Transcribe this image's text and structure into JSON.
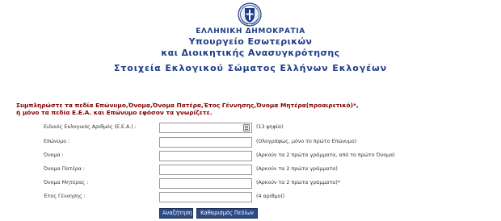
{
  "header": {
    "republic": "ΕΛΛΗΝΙΚΗ ΔΗΜΟΚΡΑΤΙΑ",
    "ministry_line1": "Υπουργείο Εσωτερικών",
    "ministry_line2": "και Διοικητικής Ανασυγκρότησης",
    "subtitle": "Στοιχεία Εκλογικού Σώματος Ελλήνων Εκλογέων"
  },
  "instructions": {
    "line1": "Συμπληρώστε τα πεδία Επώνυμο,Όνομα,Όνομα Πατέρα,Έτος Γέννησης,Όνομα Μητέρα(προαιρετικό)*,",
    "line2": "ή μόνο τα πεδία Ε.Ε.Α. και Επώνυμο εφόσον τα γνωρίζετε."
  },
  "form": {
    "fields": [
      {
        "label": "Ειδικός Εκλογικός Αριθμός (Ε.Ε.Α.) :",
        "value": "",
        "hint": "(13 ψηφία)"
      },
      {
        "label": "Επώνυμο :",
        "value": "",
        "hint": "(Ολογράφως, μόνο το πρώτο Επώνυμο)"
      },
      {
        "label": "Όνομα :",
        "value": "",
        "hint": "(Αρκούν τα 2 πρώτα γράμματα, από το πρώτο Όνομα)"
      },
      {
        "label": "Όνομα Πατέρα :",
        "value": "",
        "hint": "(Αρκούν τα 2 πρώτα γράμματα)"
      },
      {
        "label": "Όνομα Μητέρας :",
        "value": "",
        "hint": "(Αρκούν τα 2 πρώτα γράμματα)*"
      },
      {
        "label": "Έτος Γέννησης :",
        "value": "",
        "hint": "(4 αριθμοί)"
      }
    ],
    "search_label": "Αναζήτηση",
    "clear_label": "Καθαρισμός Πεδίων"
  },
  "icons": {
    "emblem": "greek-coat-of-arms-icon",
    "keyboard": "virtual-keyboard-icon"
  },
  "colors": {
    "title_blue": "#1f3c88",
    "instruction_red": "#800000",
    "button_blue": "#2c4a86"
  }
}
